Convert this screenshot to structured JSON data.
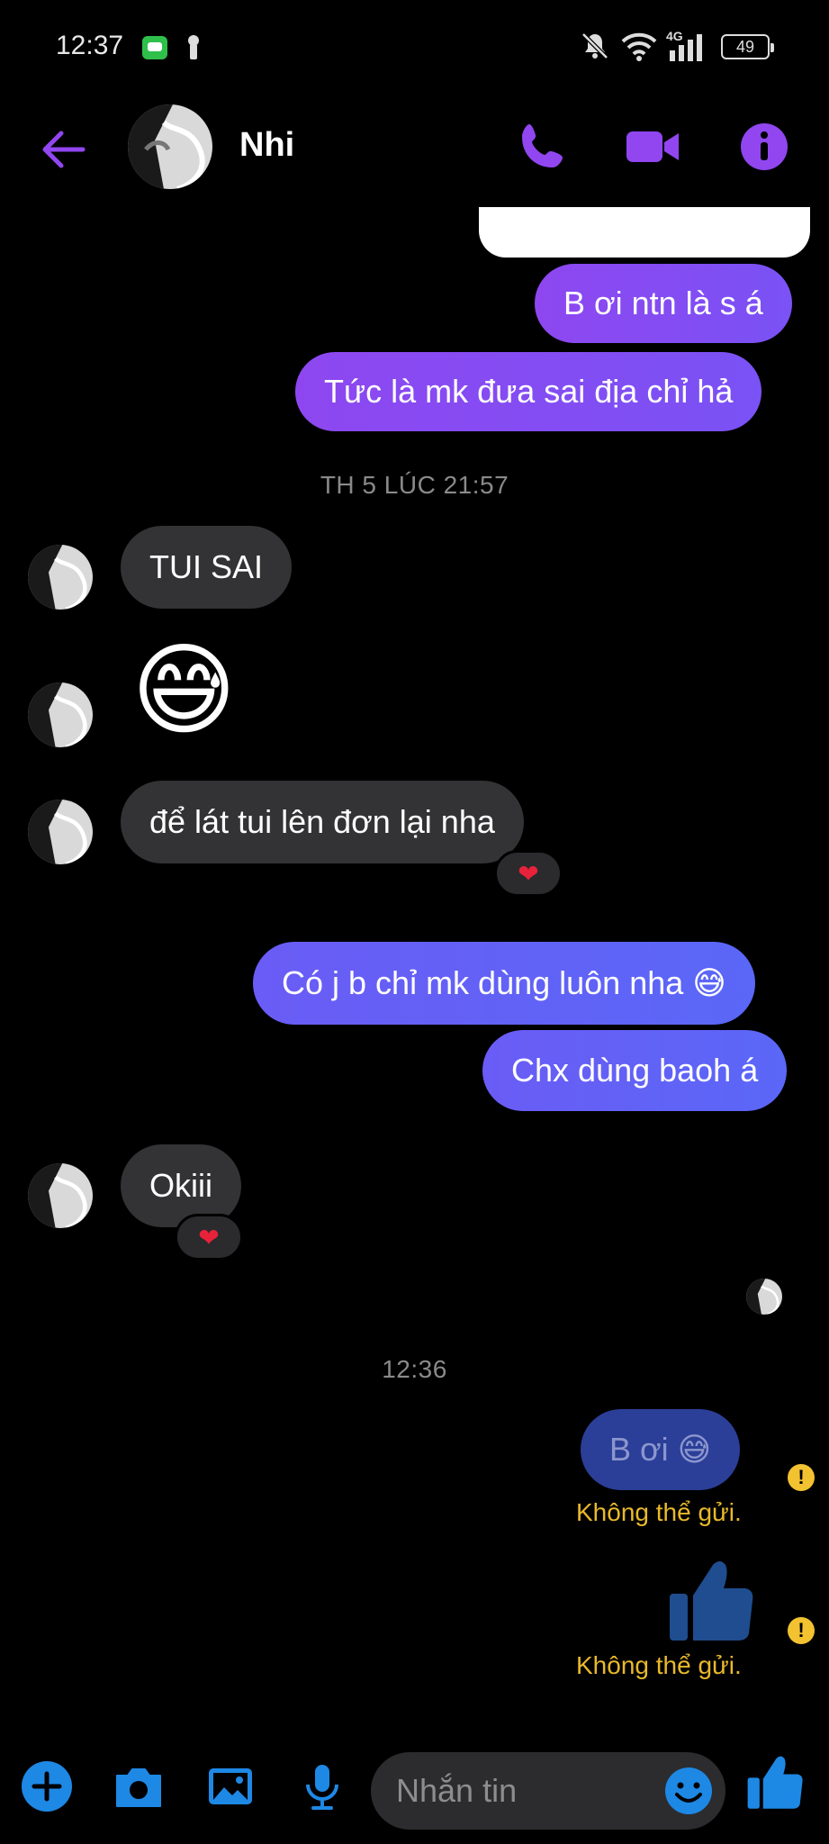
{
  "status_bar": {
    "time": "12:37",
    "battery": "49",
    "network": "4G",
    "icons": [
      "messages-app-icon",
      "key-icon",
      "mute-icon",
      "wifi-icon",
      "signal-icon",
      "battery-icon"
    ]
  },
  "header": {
    "contact_name": "Nhi",
    "icons": [
      "back-arrow-icon",
      "phone-icon",
      "video-icon",
      "info-icon"
    ]
  },
  "messages": {
    "out1": "B ơi ntn là s á",
    "out2": "Tức là mk đưa sai địa chỉ hả",
    "ts1": "TH 5 LÚC 21:57",
    "in1": "TUI SAI",
    "in2_emoji": "😅",
    "in3": "để lát tui lên đơn lại nha",
    "in3_reaction": "❤",
    "out3": "Có j b chỉ mk dùng luôn nha 😅",
    "out4": "Chx dùng baoh á",
    "in4": "Okiii",
    "in4_reaction": "❤",
    "ts2": "12:36",
    "failed1": "B ơi 😅",
    "failed1_status": "Không thể gửi.",
    "failed2_status": "Không thể gửi."
  },
  "composer": {
    "placeholder": "Nhắn tin",
    "icons": [
      "plus-icon",
      "camera-icon",
      "gallery-icon",
      "mic-icon",
      "emoji-icon",
      "like-icon"
    ]
  },
  "colors": {
    "accent_purple": "#9146f0",
    "accent_blue": "#1e88e5",
    "outgoing_bubble": "#8e47f0",
    "incoming_bubble": "#333335",
    "error_yellow": "#e9b92b"
  }
}
